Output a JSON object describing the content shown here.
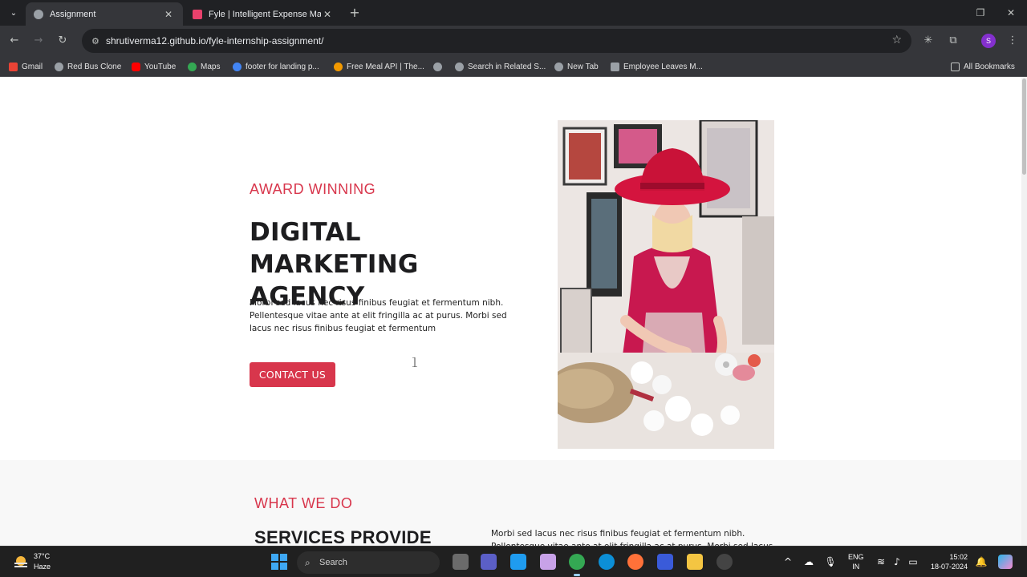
{
  "browser": {
    "tabs": [
      {
        "title": "Assignment",
        "favicon_color": "#9aa0a6"
      },
      {
        "title": "Fyle | Intelligent Expense Mana",
        "favicon_color": "#e8416c"
      }
    ],
    "url": "shrutiverma12.github.io/fyle-internship-assignment/",
    "profile_initial": "S"
  },
  "bookmarks": [
    {
      "label": "Gmail",
      "color": "#ea4335"
    },
    {
      "label": "Red Bus Clone",
      "color": "#9aa0a6"
    },
    {
      "label": "YouTube",
      "color": "#ff0000"
    },
    {
      "label": "Maps",
      "color": "#34a853"
    },
    {
      "label": "footer for landing p...",
      "color": "#4285f4"
    },
    {
      "label": "Free Meal API | The...",
      "color": "#f29900"
    },
    {
      "label": "",
      "color": "#9aa0a6"
    },
    {
      "label": "Search in Related S...",
      "color": "#9aa0a6"
    },
    {
      "label": "New Tab",
      "color": "#9aa0a6"
    },
    {
      "label": "Employee Leaves M...",
      "color": "#9aa0a6"
    }
  ],
  "all_bookmarks": "All Bookmarks",
  "page": {
    "hero": {
      "eyebrow": "AWARD WINNING",
      "headline": "DIGITAL MARKETING AGENCY",
      "text": "Morbi sed lacus nec risus finibus feugiat et fermentum nibh. Pellentesque vitae ante at elit fringilla ac at purus. Morbi sed lacus nec risus finibus feugiat et fermentum",
      "cta_label": "CONTACT US"
    },
    "services": {
      "eyebrow": "WHAT WE DO",
      "title": "SERVICES PROVIDE",
      "text": "Morbi sed lacus nec risus finibus feugiat et fermentum nibh. Pellentesque vitae ante at elit fringilla ac at purus. Morbi sed lacus"
    },
    "accent_color": "#d8364c"
  },
  "taskbar": {
    "weather_temp": "37°C",
    "weather_desc": "Haze",
    "search_placeholder": "Search",
    "lang_top": "ENG",
    "lang_bottom": "IN",
    "time": "15:02",
    "date": "18-07-2024"
  }
}
